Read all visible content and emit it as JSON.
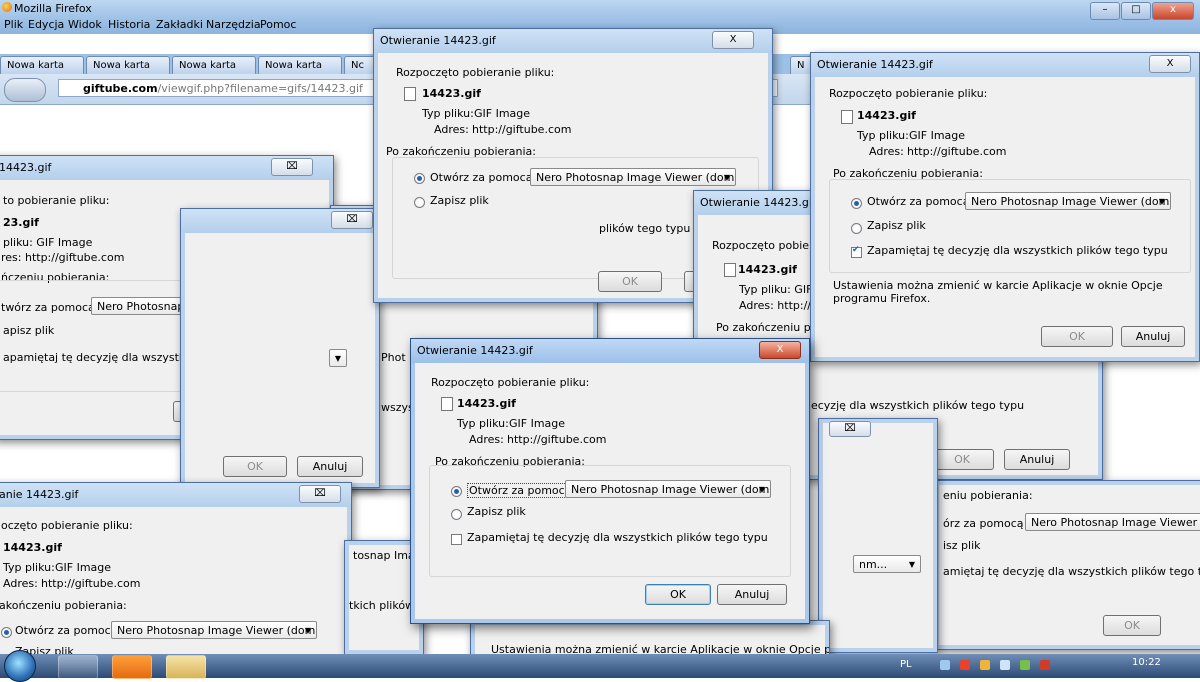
{
  "browser": {
    "window_title": "Mozilla Firefox",
    "menu": [
      "Plik",
      "Edycja",
      "Widok",
      "Historia",
      "Zakładki",
      "Narzędzia",
      "Pomoc"
    ],
    "tabs": [
      "Nowa karta",
      "Nowa karta",
      "Nowa karta",
      "Nowa karta",
      "Nc",
      "N"
    ],
    "url_domain": "giftube.com",
    "url_path": "/viewgif.php?filename=gifs/14423.gif",
    "window_controls": {
      "minimize": "–",
      "maximize": "□",
      "close": "x"
    }
  },
  "dialog": {
    "title": "Otwieranie 14423.gif",
    "title_partial_left": "14423.gif",
    "title_partial_bottom": "anie 14423.gif",
    "started": "Rozpoczęto pobieranie pliku:",
    "started_partial": "to pobieranie pliku:",
    "started_partial2": "Rozpoczęto pobieran",
    "started_partial3": "oczęto pobieranie pliku:",
    "filename": "14423.gif",
    "filename_partial": "23.gif",
    "type_label": "Typ pliku:",
    "type_value": "GIF Image",
    "type_partial": "pliku:  GIF Image",
    "type_partial2": "Typ pliku:  GIF I",
    "address_label": "Adres:",
    "address_value": "http://giftube.com",
    "address_partial": "res:  http://giftube.com",
    "address_partial2": "Adres:  http://g",
    "after_download": "Po zakończeniu pobierania:",
    "after_partial": "ńczeniu pobierania:",
    "after_partial2": "Po zakończeniu pob",
    "after_partial3": "akończeniu pobierania:",
    "after_partial4": "eniu pobierania:",
    "open_with": "Otwórz za pomocą",
    "open_with_partial": "twórz za pomocą",
    "open_with_partial2": "órz za pomocą",
    "app": "Nero Photosnap Image Viewer (dom...",
    "app_partial": "Nero Photosnap Image Viewer (dom",
    "app_partial2": "nm...",
    "app_partial3": "Phot",
    "app_partial4": "tosnap Imag",
    "save": "Zapisz plik",
    "save_partial": "apisz plik",
    "save_partial2": "isz plik",
    "remember": "Zapamiętaj tę decyzję dla wszystkich plików tego typu",
    "remember_partial": "apamiętaj tę decyzję dla wszystkich plików tego typu",
    "remember_partial2": "decyzję dla wszystkich plików tego typu",
    "remember_partial3": "amiętaj tę decyzję dla wszystkich plików tego typu",
    "remember_partial4": "plików tego typu",
    "remember_partial5": "wszyst",
    "remember_partial6": "tkich plików",
    "settings_note": "Ustawienia można zmienić w karcie Aplikacje w oknie Opcje programu Firefox.",
    "settings_note_line": "Ustawienia można zmienić w karcie Aplikacje w oknie Opcje programu",
    "ok": "OK",
    "cancel": "Anuluj",
    "cancel_partial": "Ar",
    "close_glyph": "X",
    "close_glyph_inactive": "⌧"
  },
  "taskbar": {
    "lang": "PL",
    "clock": "10:22",
    "apps": [
      "start",
      "firefox",
      "vlc",
      "explorer"
    ]
  },
  "colors": {
    "accent": "#2a5db0",
    "titlebar": "#b4cfec",
    "taskbar": "#2c4a73"
  }
}
